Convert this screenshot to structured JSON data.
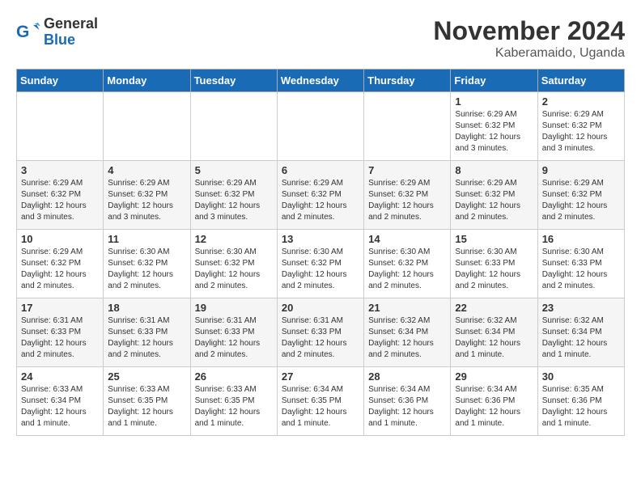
{
  "logo": {
    "general": "General",
    "blue": "Blue"
  },
  "title": "November 2024",
  "subtitle": "Kaberamaido, Uganda",
  "weekdays": [
    "Sunday",
    "Monday",
    "Tuesday",
    "Wednesday",
    "Thursday",
    "Friday",
    "Saturday"
  ],
  "weeks": [
    [
      {
        "day": "",
        "info": ""
      },
      {
        "day": "",
        "info": ""
      },
      {
        "day": "",
        "info": ""
      },
      {
        "day": "",
        "info": ""
      },
      {
        "day": "",
        "info": ""
      },
      {
        "day": "1",
        "info": "Sunrise: 6:29 AM\nSunset: 6:32 PM\nDaylight: 12 hours and 3 minutes."
      },
      {
        "day": "2",
        "info": "Sunrise: 6:29 AM\nSunset: 6:32 PM\nDaylight: 12 hours and 3 minutes."
      }
    ],
    [
      {
        "day": "3",
        "info": "Sunrise: 6:29 AM\nSunset: 6:32 PM\nDaylight: 12 hours and 3 minutes."
      },
      {
        "day": "4",
        "info": "Sunrise: 6:29 AM\nSunset: 6:32 PM\nDaylight: 12 hours and 3 minutes."
      },
      {
        "day": "5",
        "info": "Sunrise: 6:29 AM\nSunset: 6:32 PM\nDaylight: 12 hours and 3 minutes."
      },
      {
        "day": "6",
        "info": "Sunrise: 6:29 AM\nSunset: 6:32 PM\nDaylight: 12 hours and 2 minutes."
      },
      {
        "day": "7",
        "info": "Sunrise: 6:29 AM\nSunset: 6:32 PM\nDaylight: 12 hours and 2 minutes."
      },
      {
        "day": "8",
        "info": "Sunrise: 6:29 AM\nSunset: 6:32 PM\nDaylight: 12 hours and 2 minutes."
      },
      {
        "day": "9",
        "info": "Sunrise: 6:29 AM\nSunset: 6:32 PM\nDaylight: 12 hours and 2 minutes."
      }
    ],
    [
      {
        "day": "10",
        "info": "Sunrise: 6:29 AM\nSunset: 6:32 PM\nDaylight: 12 hours and 2 minutes."
      },
      {
        "day": "11",
        "info": "Sunrise: 6:30 AM\nSunset: 6:32 PM\nDaylight: 12 hours and 2 minutes."
      },
      {
        "day": "12",
        "info": "Sunrise: 6:30 AM\nSunset: 6:32 PM\nDaylight: 12 hours and 2 minutes."
      },
      {
        "day": "13",
        "info": "Sunrise: 6:30 AM\nSunset: 6:32 PM\nDaylight: 12 hours and 2 minutes."
      },
      {
        "day": "14",
        "info": "Sunrise: 6:30 AM\nSunset: 6:32 PM\nDaylight: 12 hours and 2 minutes."
      },
      {
        "day": "15",
        "info": "Sunrise: 6:30 AM\nSunset: 6:33 PM\nDaylight: 12 hours and 2 minutes."
      },
      {
        "day": "16",
        "info": "Sunrise: 6:30 AM\nSunset: 6:33 PM\nDaylight: 12 hours and 2 minutes."
      }
    ],
    [
      {
        "day": "17",
        "info": "Sunrise: 6:31 AM\nSunset: 6:33 PM\nDaylight: 12 hours and 2 minutes."
      },
      {
        "day": "18",
        "info": "Sunrise: 6:31 AM\nSunset: 6:33 PM\nDaylight: 12 hours and 2 minutes."
      },
      {
        "day": "19",
        "info": "Sunrise: 6:31 AM\nSunset: 6:33 PM\nDaylight: 12 hours and 2 minutes."
      },
      {
        "day": "20",
        "info": "Sunrise: 6:31 AM\nSunset: 6:33 PM\nDaylight: 12 hours and 2 minutes."
      },
      {
        "day": "21",
        "info": "Sunrise: 6:32 AM\nSunset: 6:34 PM\nDaylight: 12 hours and 2 minutes."
      },
      {
        "day": "22",
        "info": "Sunrise: 6:32 AM\nSunset: 6:34 PM\nDaylight: 12 hours and 1 minute."
      },
      {
        "day": "23",
        "info": "Sunrise: 6:32 AM\nSunset: 6:34 PM\nDaylight: 12 hours and 1 minute."
      }
    ],
    [
      {
        "day": "24",
        "info": "Sunrise: 6:33 AM\nSunset: 6:34 PM\nDaylight: 12 hours and 1 minute."
      },
      {
        "day": "25",
        "info": "Sunrise: 6:33 AM\nSunset: 6:35 PM\nDaylight: 12 hours and 1 minute."
      },
      {
        "day": "26",
        "info": "Sunrise: 6:33 AM\nSunset: 6:35 PM\nDaylight: 12 hours and 1 minute."
      },
      {
        "day": "27",
        "info": "Sunrise: 6:34 AM\nSunset: 6:35 PM\nDaylight: 12 hours and 1 minute."
      },
      {
        "day": "28",
        "info": "Sunrise: 6:34 AM\nSunset: 6:36 PM\nDaylight: 12 hours and 1 minute."
      },
      {
        "day": "29",
        "info": "Sunrise: 6:34 AM\nSunset: 6:36 PM\nDaylight: 12 hours and 1 minute."
      },
      {
        "day": "30",
        "info": "Sunrise: 6:35 AM\nSunset: 6:36 PM\nDaylight: 12 hours and 1 minute."
      }
    ]
  ]
}
